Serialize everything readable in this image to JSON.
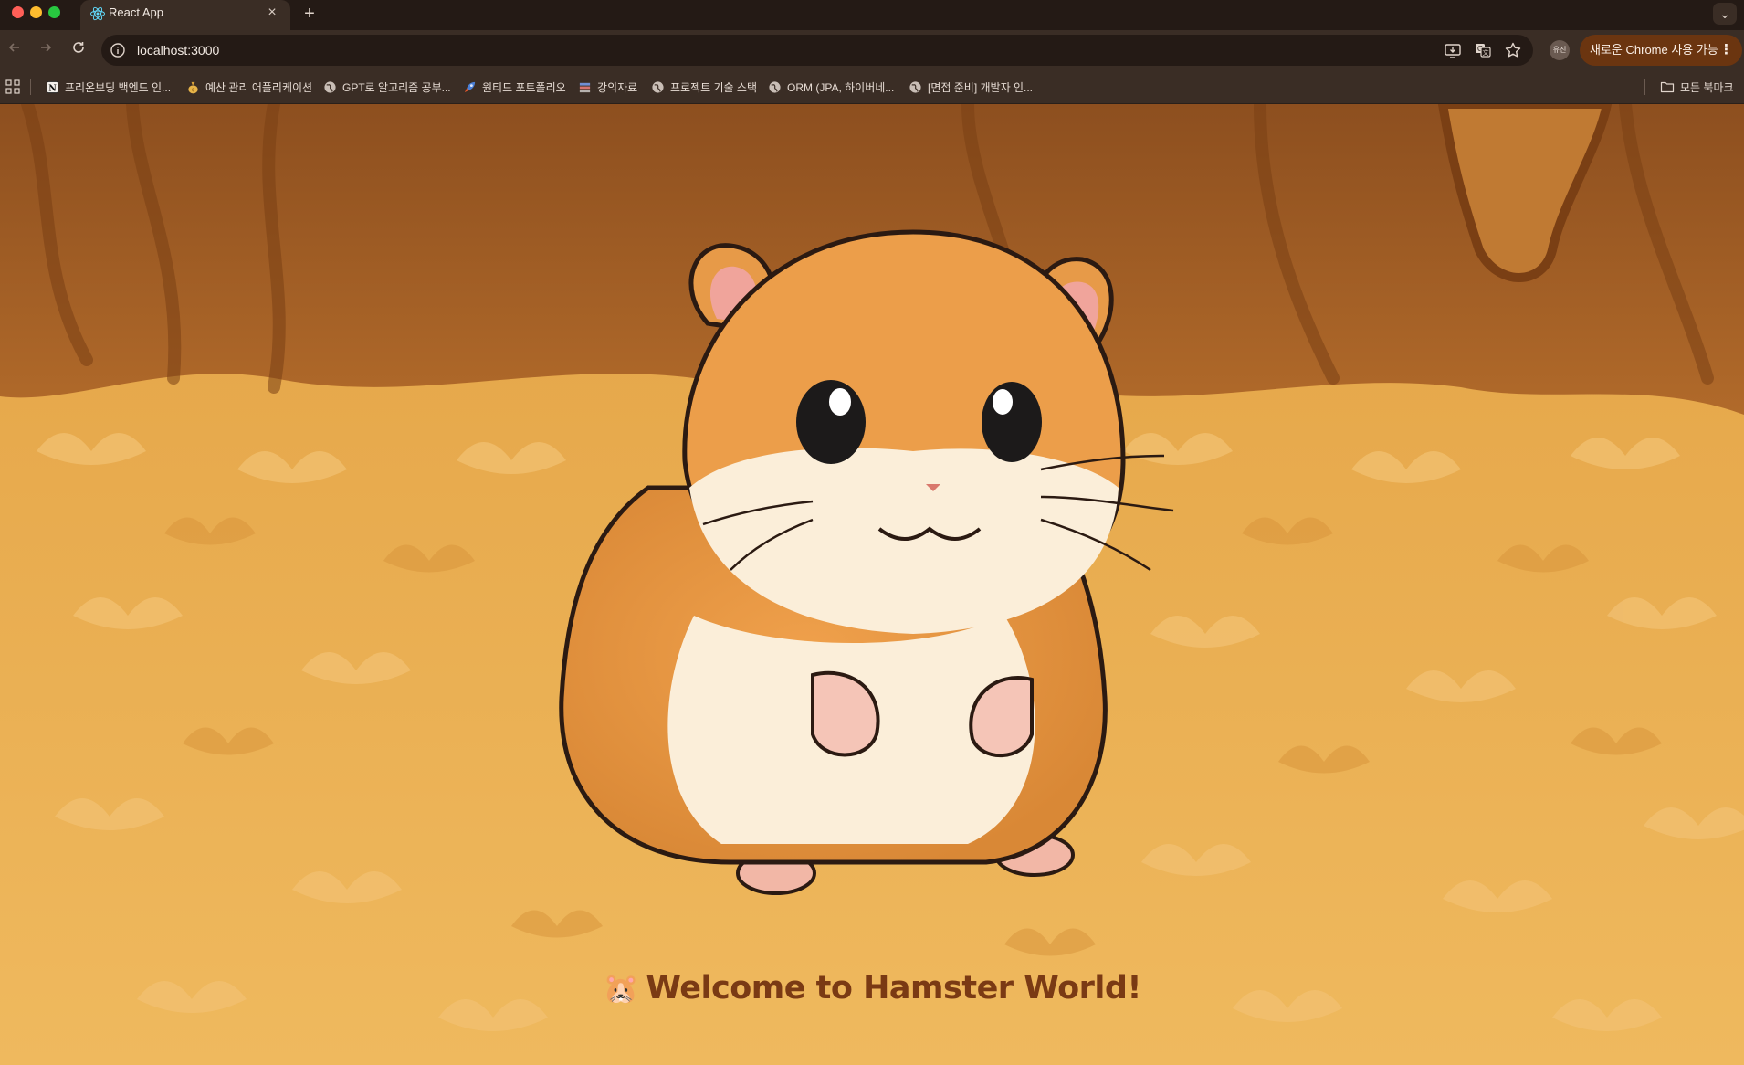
{
  "browser": {
    "tab": {
      "title": "React App",
      "close": "×"
    },
    "new_tab": "+",
    "tab_search": "⌄",
    "address": "localhost:3000",
    "profile_initials": "유진",
    "update_label": "새로운 Chrome 사용 가능",
    "update_menu": "⋮"
  },
  "bookmarks": [
    {
      "label": "프리온보딩 백엔드 인...",
      "icon": "notion-icon"
    },
    {
      "label": "예산 관리 어플리케이션",
      "icon": "money-bag-icon"
    },
    {
      "label": "GPT로 알고리즘 공부...",
      "icon": "globe-icon"
    },
    {
      "label": "원티드 포트폴리오",
      "icon": "rocket-icon"
    },
    {
      "label": "강의자료",
      "icon": "books-icon"
    },
    {
      "label": "프로젝트 기술 스택",
      "icon": "globe-icon"
    },
    {
      "label": "ORM (JPA, 하이버네...",
      "icon": "globe-icon"
    },
    {
      "label": "[면접 준비] 개발자 인...",
      "icon": "globe-icon"
    }
  ],
  "all_bookmarks": "모든 북마크",
  "page": {
    "welcome_emoji": "🐹",
    "welcome_text": "Welcome to Hamster World!"
  },
  "colors": {
    "tab_strip": "#241a15",
    "toolbar": "#3a2d25",
    "update_button": "#6b3510",
    "page_background": "#e7ab4f",
    "welcome_text": "#7a3a14"
  }
}
